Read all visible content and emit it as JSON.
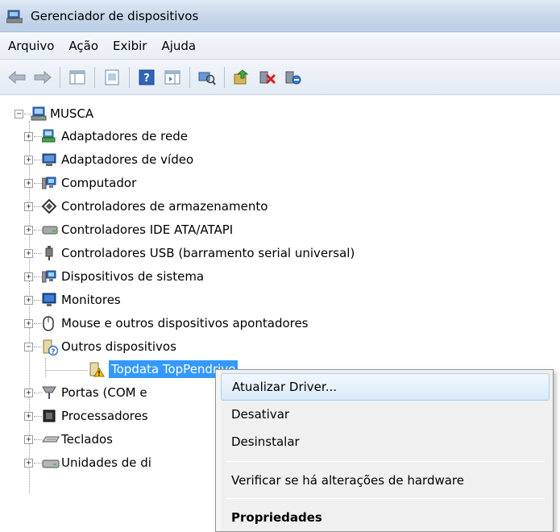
{
  "window": {
    "title": "Gerenciador de dispositivos",
    "icon": "device-manager-icon"
  },
  "menu": [
    "Arquivo",
    "Ação",
    "Exibir",
    "Ajuda"
  ],
  "toolbar": {
    "buttons": [
      "back-arrow-icon",
      "forward-arrow-icon",
      "show-hide-tree-icon",
      "properties-icon",
      "help-icon",
      "action-pane-icon",
      "scan-hardware-icon",
      "update-driver-icon",
      "uninstall-icon",
      "disable-icon"
    ]
  },
  "tree": {
    "root": "MUSCA",
    "categories": [
      "Adaptadores de rede",
      "Adaptadores de vídeo",
      "Computador",
      "Controladores de armazenamento",
      "Controladores IDE ATA/ATAPI",
      "Controladores USB (barramento serial universal)",
      "Dispositivos de sistema",
      "Monitores",
      "Mouse e outros dispositivos apontadores",
      "Outros dispositivos"
    ],
    "other_devices_child": "Topdata TopPendrive",
    "after_categories": [
      "Portas (COM e",
      "Processadores",
      "Teclados",
      "Unidades de di"
    ]
  },
  "context_menu": {
    "update_driver": "Atualizar Driver...",
    "disable": "Desativar",
    "uninstall": "Desinstalar",
    "scan": "Verificar se há alterações de hardware",
    "properties": "Propriedades"
  },
  "colors": {
    "selection": "#3399ff",
    "title_bar": "#c6d6ea"
  }
}
